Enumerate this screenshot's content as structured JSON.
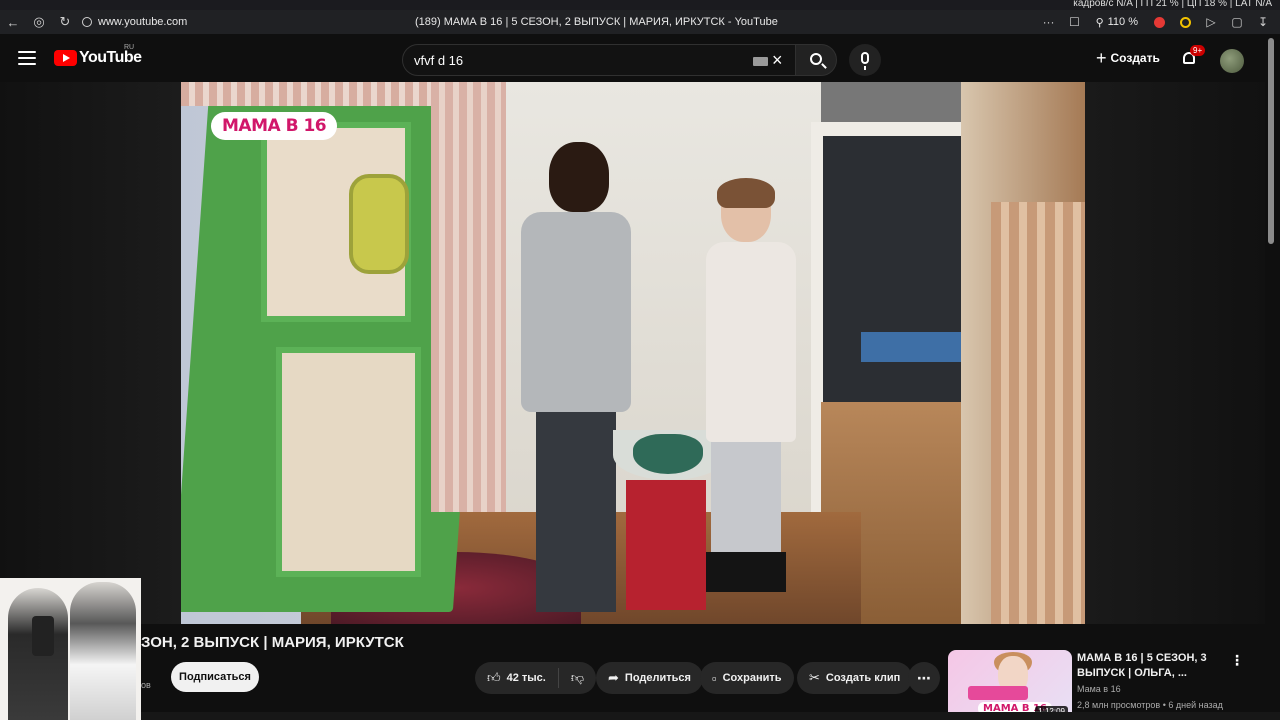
{
  "os_overlay": {
    "stats": "кадров/с N/A | ГП 21 % | ЦП 18 % | LAT N/A"
  },
  "browser": {
    "url": "www.youtube.com",
    "page_title": "(189) МАМА В 16 | 5 СЕЗОН, 2 ВЫПУСК | МАРИЯ, ИРКУТСК - YouTube",
    "zoom": "110 %",
    "more": "···"
  },
  "header": {
    "logo_text": "YouTube",
    "region": "RU",
    "search_query": "vfvf d 16",
    "create_label": "Создать",
    "notification_count": "9+"
  },
  "player": {
    "show_badge": "МАМА В 16"
  },
  "video": {
    "title": "ЗОН, 2 ВЫПУСК | МАРИЯ, ИРКУТСК",
    "subscribe_label": "Подписаться",
    "channel_partial": "ов",
    "likes": "42 тыс.",
    "share_label": "Поделиться",
    "save_label": "Сохранить",
    "clip_label": "Создать клип"
  },
  "related": {
    "title": "МАМА В 16 | 5 СЕЗОН, 3 ВЫПУСК | ОЛЬГА, ...",
    "channel": "Мама в 16",
    "meta": "2,8 млн просмотров • 6 дней назад",
    "duration": "1:12:09",
    "thumb_logo": "МАМА В 16"
  },
  "colors": {
    "brand_red": "#ff0000",
    "badge_pink": "#d1176a",
    "background": "#0f0f0f"
  }
}
